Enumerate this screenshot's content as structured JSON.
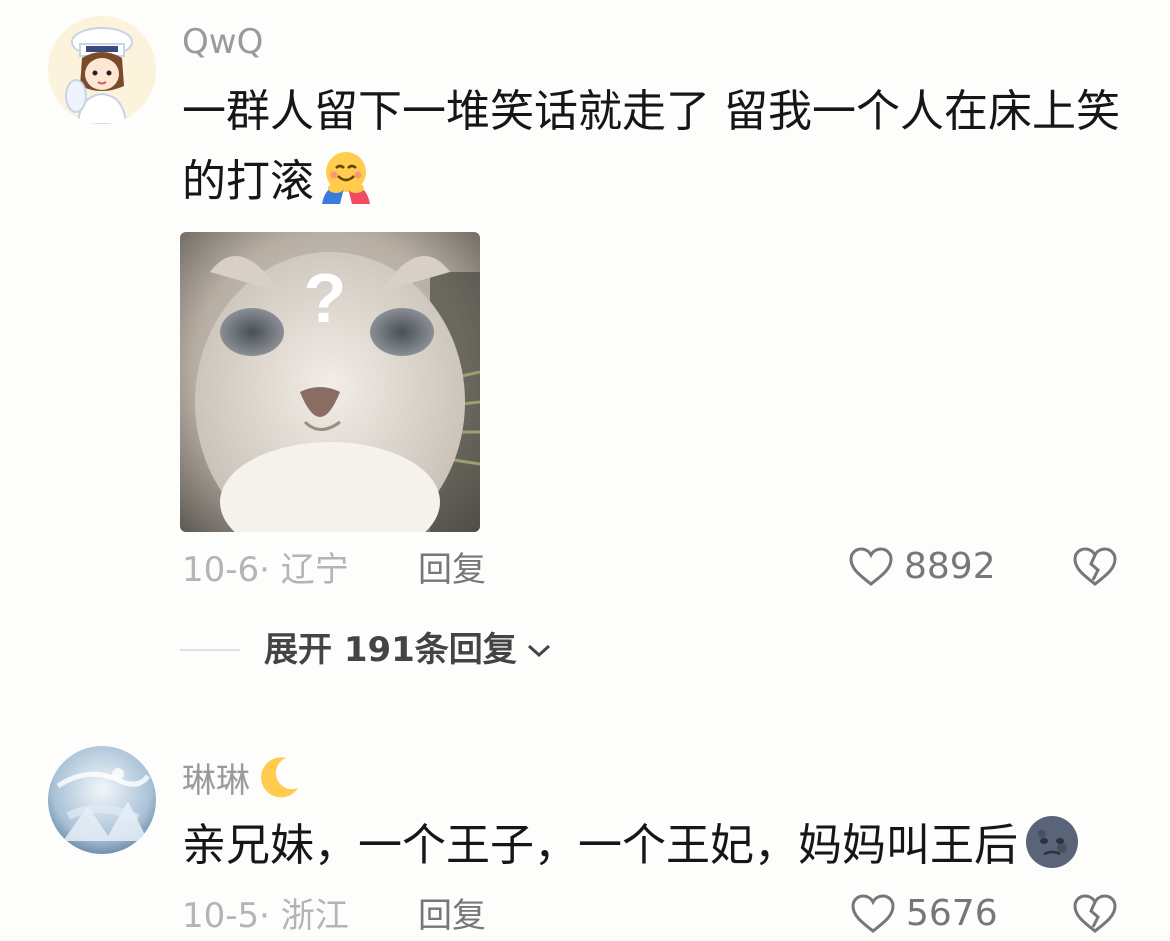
{
  "comments": [
    {
      "username": "QwQ",
      "text_line1": "一群人留下一堆笑话就走了 留我一个人在床上笑",
      "text_line2": "的打滚",
      "emoji_icon": "hugging-face-emoji",
      "image_icon": "confused-cat-meme",
      "image_overlay_text": "?",
      "date_location": "10-6· 辽宁",
      "reply_label": "回复",
      "like_count": "8892",
      "expand_replies": "展开 191条回复"
    },
    {
      "username": "琳琳",
      "username_icon": "crescent-moon-emoji",
      "text": "亲兄妹，一个王子，一个王妃，妈妈叫王后",
      "emoji_icon": "new-moon-face-emoji",
      "date_location": "10-5· 浙江",
      "reply_label": "回复",
      "like_count": "5676"
    }
  ],
  "colors": {
    "background": "#fdfdfb",
    "username": "#9a9a9a",
    "text": "#161616",
    "meta": "#b4b4b4",
    "action": "#777777"
  }
}
